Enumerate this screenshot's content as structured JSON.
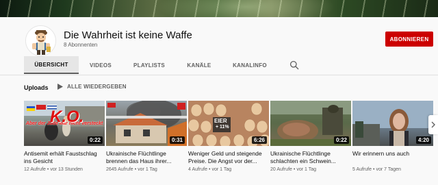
{
  "channel": {
    "name": "Die Wahrheit ist keine Waffe",
    "subscribers": "8 Abonnenten",
    "subscribe_label": "ABONNIEREN"
  },
  "tabs": [
    {
      "label": "ÜBERSICHT",
      "active": true
    },
    {
      "label": "VIDEOS",
      "active": false
    },
    {
      "label": "PLAYLISTS",
      "active": false
    },
    {
      "label": "KANÄLE",
      "active": false
    },
    {
      "label": "KANALINFO",
      "active": false
    }
  ],
  "icons": {
    "search": "search-icon",
    "play": "play-icon",
    "next": "chevron-right-icon"
  },
  "uploads": {
    "title": "Uploads",
    "play_all_label": "ALLE WIEDERGEBEN"
  },
  "videos": [
    {
      "title": "Antisemit erhält Faustschlag ins Gesicht",
      "views": "12 Aufrufe",
      "age": "vor 13 Stunden",
      "duration": "0:22",
      "overlay_text": "Aber der Jude war nicht versteckt",
      "overlay_text2": "K.O."
    },
    {
      "title": "Ukrainische Flüchtlinge brennen das Haus ihrer...",
      "views": "2645 Aufrufe",
      "age": "vor 1 Tag",
      "duration": "0:31"
    },
    {
      "title": "Weniger Geld und steigende Preise. Die Angst vor der...",
      "views": "4 Aufrufe",
      "age": "vor 1 Tag",
      "duration": "6:26",
      "overlay_text": "EIER",
      "overlay_text2": "+ 11%"
    },
    {
      "title": "Ukrainische Flüchtlinge schlachten ein Schwein...",
      "views": "20 Aufrufe",
      "age": "vor 1 Tag",
      "duration": "0:22"
    },
    {
      "title": "Wir erinnern uns auch",
      "views": "5 Aufrufe",
      "age": "vor 7 Tagen",
      "duration": "4:20"
    }
  ],
  "colors": {
    "subscribe": "#cc0000",
    "background": "#f9f9f9",
    "tab_active_bg": "#e6e6e6"
  }
}
